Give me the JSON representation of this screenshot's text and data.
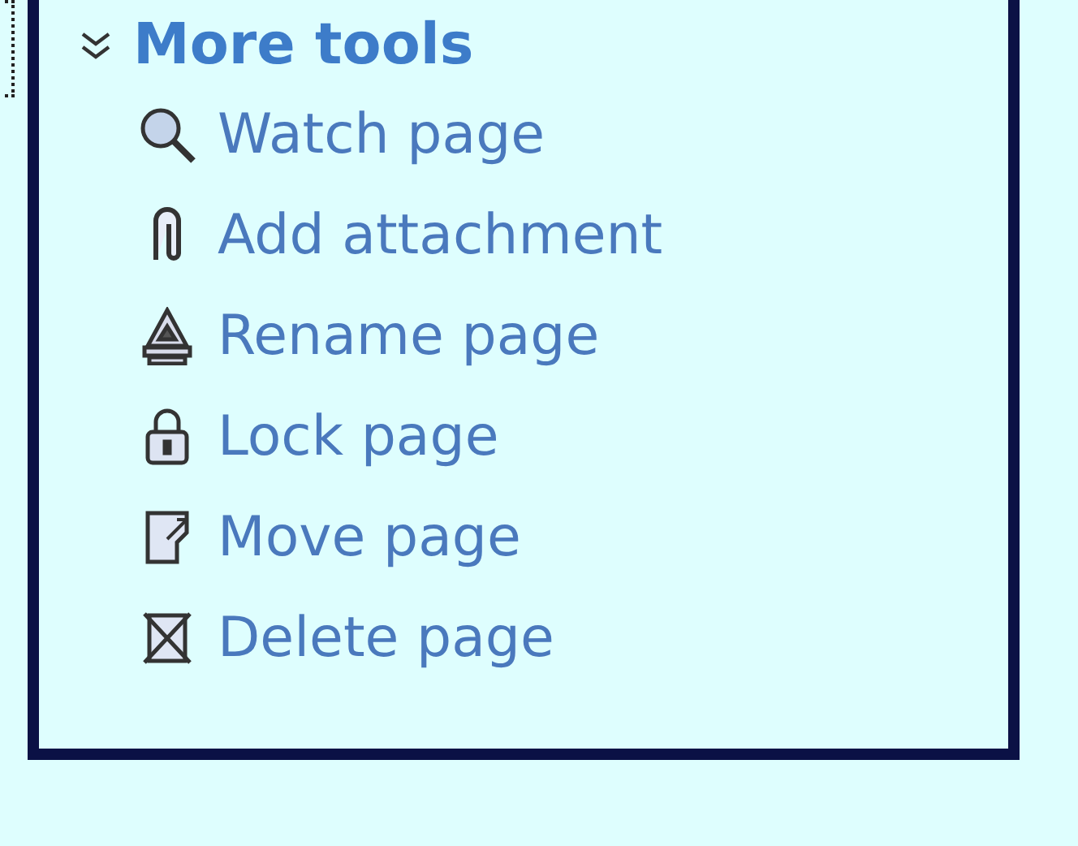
{
  "section": {
    "title": "More tools",
    "expanded": true,
    "items": [
      {
        "label": "Watch page"
      },
      {
        "label": "Add attachment"
      },
      {
        "label": "Rename page"
      },
      {
        "label": "Lock page"
      },
      {
        "label": "Move page"
      },
      {
        "label": "Delete page"
      }
    ]
  }
}
